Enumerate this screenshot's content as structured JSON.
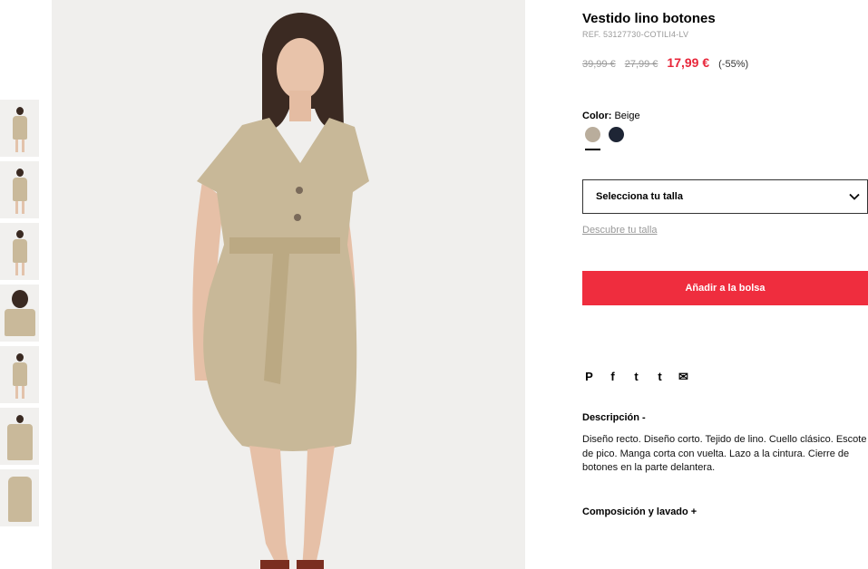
{
  "product": {
    "title": "Vestido lino botones",
    "ref": "REF. 53127730-COTILI4-LV",
    "prices": {
      "original": "39,99 €",
      "previous": "27,99 €",
      "current": "17,99 €",
      "discount": "(-55%)"
    },
    "color": {
      "label": "Color:",
      "value": "Beige",
      "swatches": [
        {
          "name": "Beige",
          "hex": "#b9ad9c"
        },
        {
          "name": "Navy",
          "hex": "#1e2535"
        }
      ]
    },
    "size": {
      "placeholder": "Selecciona tu talla",
      "help_link": "Descubre tu talla"
    },
    "add_to_bag": "Añadir a la bolsa",
    "social": {
      "pinterest": "P",
      "facebook": "f",
      "twitter": "t",
      "tumblr": "t",
      "email": "✉"
    },
    "description": {
      "title": "Descripción -",
      "text": "Diseño recto. Diseño corto. Tejido de lino. Cuello clásico. Escote de pico. Manga corta con vuelta. Lazo a la cintura. Cierre de botones en la parte delantera."
    },
    "composition": {
      "title": "Composición y lavado +"
    }
  },
  "gallery": {
    "thumbnail_count": 7,
    "icons": [
      "dress-photo",
      "chevron-down-icon",
      "pinterest-icon",
      "facebook-icon",
      "twitter-icon",
      "tumblr-icon",
      "email-icon"
    ]
  },
  "colors": {
    "accent": "#ef2d3e",
    "price_sale": "#e8263a",
    "muted": "#999999",
    "dress": "#c9b99a"
  }
}
